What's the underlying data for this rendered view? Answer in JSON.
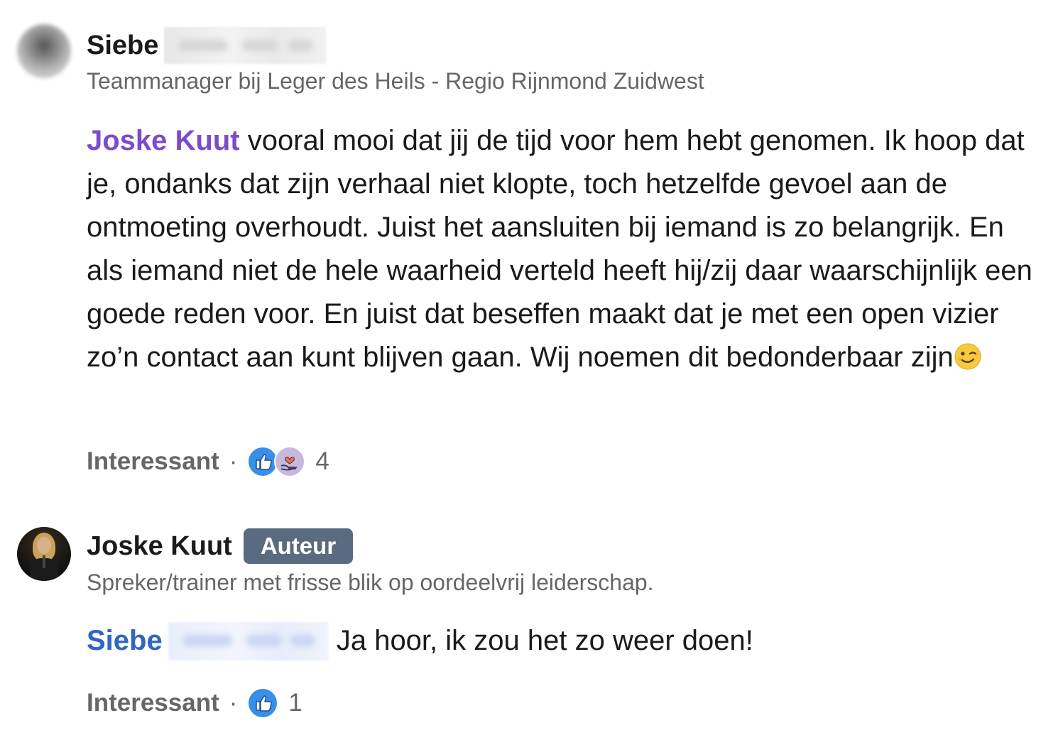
{
  "comments": [
    {
      "author_first_name": "Siebe",
      "headline": "Teammanager bij Leger des Heils - Regio Rijnmond Zuidwest",
      "mention": "Joske Kuut",
      "body_part1": " vooral mooi dat jij de tijd voor hem hebt genomen. Ik hoop dat je, ondanks dat zijn verhaal niet klopte, toch hetzelfde gevoel aan de ontmoeting overhoudt. Juist het aansluiten bij iemand is zo belangrijk. En als iemand niet de hele waarheid verteld heeft hij/zij daar waarschijnlijk een goede reden voor. En juist dat beseffen maakt dat je met een open vizier zo’n contact aan kunt blijven gaan. Wij noemen dit bedonderbaar zijn",
      "emoji": "winking-face",
      "reaction_label": "Interessant",
      "reaction_separator": "·",
      "reaction_types": [
        "like",
        "support"
      ],
      "reaction_count": "4"
    },
    {
      "author_name": "Joske Kuut",
      "badge": "Auteur",
      "headline": "Spreker/trainer met frisse blik op oordeelvrij leiderschap.",
      "mention_first_name": "Siebe",
      "body": " Ja hoor, ik zou het zo weer doen!",
      "reaction_label": "Interessant",
      "reaction_separator": "·",
      "reaction_types": [
        "like"
      ],
      "reaction_count": "1"
    }
  ],
  "colors": {
    "mention_purple": "#7b4cc9",
    "mention_blue": "#2f66c4",
    "badge_bg": "#5a6a80",
    "like_blue": "#378fe9",
    "secondary_text": "#666666"
  }
}
